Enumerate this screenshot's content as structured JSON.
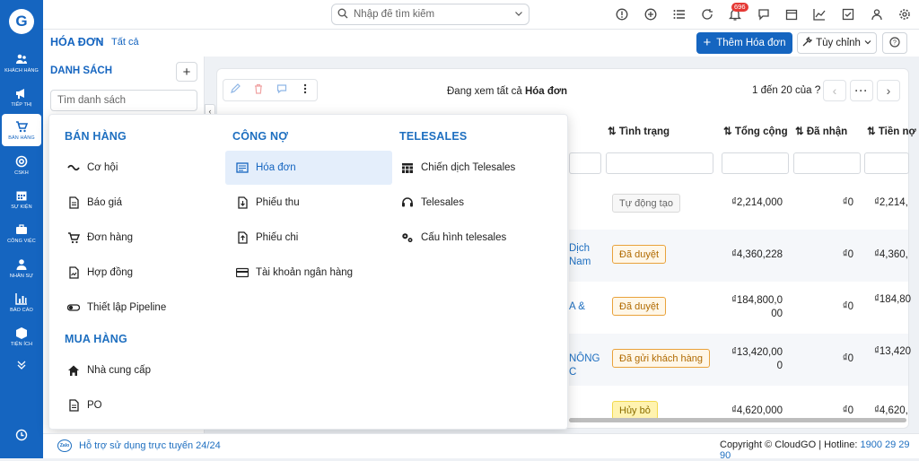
{
  "colors": {
    "brand": "#1565c0",
    "badge_draft_border": "#cfcfcf",
    "badge_approved": "#e9a23b",
    "badge_cancel": "#f2d94e"
  },
  "rail": {
    "items": [
      {
        "label": "KHÁCH HÀNG",
        "icon": "users-icon"
      },
      {
        "label": "TIẾP THỊ",
        "icon": "megaphone-icon"
      },
      {
        "label": "BÁN HÀNG",
        "icon": "cart-icon"
      },
      {
        "label": "CSKH",
        "icon": "support-icon"
      },
      {
        "label": "SỰ KIỆN",
        "icon": "calendar-icon"
      },
      {
        "label": "CÔNG VIỆC",
        "icon": "briefcase-icon"
      },
      {
        "label": "NHÂN SỰ",
        "icon": "person-icon"
      },
      {
        "label": "BÁO CÁO",
        "icon": "report-icon"
      },
      {
        "label": "TIỆN ÍCH",
        "icon": "box-icon"
      }
    ]
  },
  "topbar": {
    "search_placeholder": "Nhập để tìm kiếm",
    "notif_count": "696"
  },
  "header": {
    "title": "HÓA ĐƠN",
    "breadcrumb": "Tất cả",
    "add_label": "Thêm Hóa đơn",
    "custom_label": "Tùy chỉnh"
  },
  "listpanel": {
    "title": "DANH SÁCH",
    "search_placeholder": "Tìm danh sách"
  },
  "main": {
    "viewing_prefix": "Đang xem tất cả ",
    "viewing_entity": "Hóa đơn",
    "pager": "1 đến 20 của"
  },
  "table": {
    "headers": [
      "Tình trạng",
      "Tổng cộng",
      "Đã nhận",
      "Tiền nợ"
    ],
    "rows": [
      {
        "name": "",
        "status": "Tự động tạo",
        "status_kind": "draft",
        "total": "₫2,214,000",
        "received": "₫0",
        "due": "₫2,214,"
      },
      {
        "name": "Dịch\nNam",
        "status": "Đã duyệt",
        "status_kind": "approved",
        "total": "₫4,360,228",
        "received": "₫0",
        "due": "₫4,360,"
      },
      {
        "name": "A &",
        "status": "Đã duyệt",
        "status_kind": "approved",
        "total": "₫184,800,0\n00",
        "received": "₫0",
        "due": "₫184,80"
      },
      {
        "name": "NÔNG\nC",
        "status": "Đã gửi khách hàng",
        "status_kind": "approved",
        "total": "₫13,420,00\n0",
        "received": "₫0",
        "due": "₫13,420"
      },
      {
        "name": "",
        "status": "Hủy bỏ",
        "status_kind": "cancel",
        "total": "₫4,620,000",
        "received": "₫0",
        "due": "₫4,620,"
      }
    ]
  },
  "mega": {
    "sections": [
      {
        "title": "BÁN HÀNG",
        "items": [
          {
            "label": "Cơ hội",
            "icon": "opportunity-icon"
          },
          {
            "label": "Báo giá",
            "icon": "quote-icon"
          },
          {
            "label": "Đơn hàng",
            "icon": "cart-icon"
          },
          {
            "label": "Hợp đồng",
            "icon": "contract-icon"
          },
          {
            "label": "Thiết lập Pipeline",
            "icon": "pipeline-icon"
          }
        ]
      },
      {
        "title": "MUA HÀNG",
        "items": [
          {
            "label": "Nhà cung cấp",
            "icon": "home-icon"
          },
          {
            "label": "PO",
            "icon": "document-icon"
          }
        ]
      },
      {
        "title": "CÔNG NỢ",
        "items": [
          {
            "label": "Hóa đơn",
            "icon": "invoice-icon"
          },
          {
            "label": "Phiếu thu",
            "icon": "receipt-in-icon"
          },
          {
            "label": "Phiếu chi",
            "icon": "receipt-out-icon"
          },
          {
            "label": "Tài khoản ngân hàng",
            "icon": "bank-card-icon"
          }
        ]
      },
      {
        "title": "TELESALES",
        "items": [
          {
            "label": "Chiến dịch Telesales",
            "icon": "campaign-icon"
          },
          {
            "label": "Telesales",
            "icon": "headset-icon"
          },
          {
            "label": "Cấu hình telesales",
            "icon": "cogs-icon"
          }
        ]
      }
    ]
  },
  "footer": {
    "zalo": "Zalo",
    "support": "Hỗ trợ sử dụng trực tuyến 24/24",
    "copyright": "Copyright © CloudGO | Hotline: ",
    "hotline": "1900 29 29 90"
  }
}
